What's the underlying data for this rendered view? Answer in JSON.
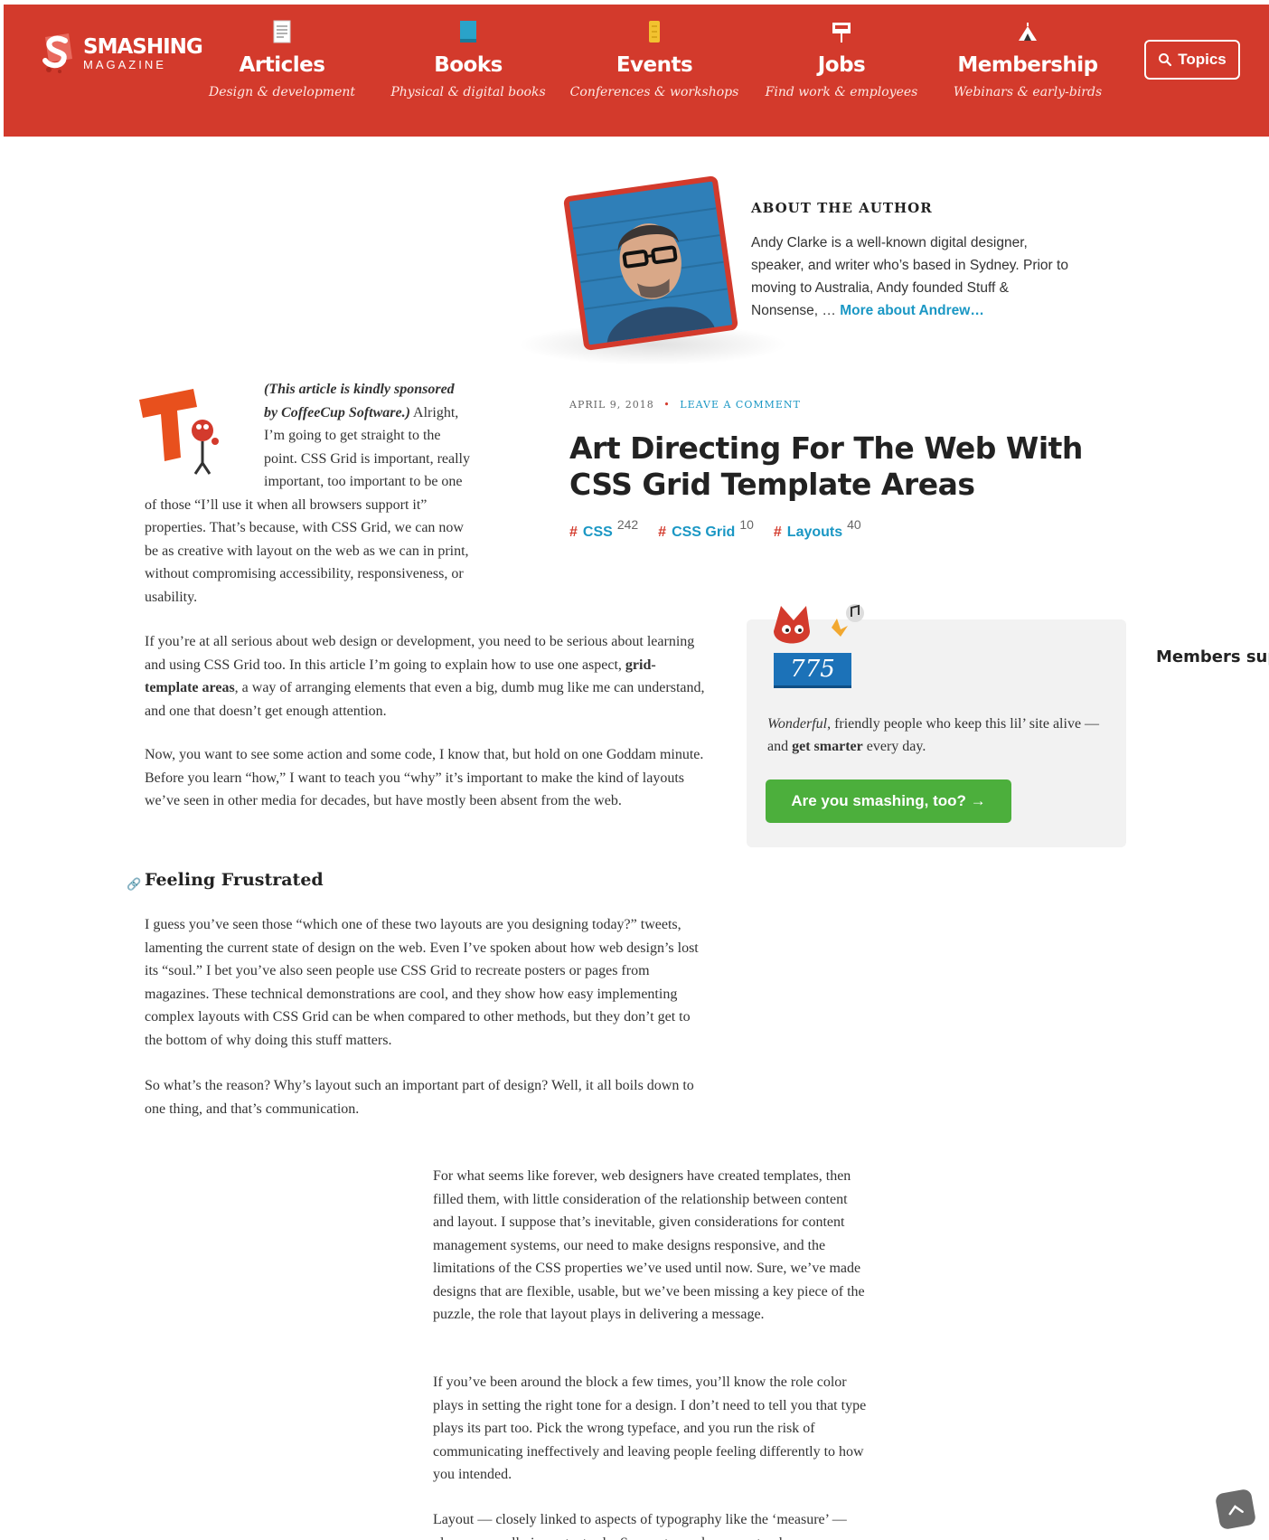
{
  "brand": {
    "name": "SMASHING",
    "sub": "MAGAZINE",
    "accent": "#d33a2c",
    "link": "#1a97c4",
    "success": "#4caf3c"
  },
  "nav": [
    {
      "label": "Articles",
      "sub": "Design & development",
      "icon": "document-icon"
    },
    {
      "label": "Books",
      "sub": "Physical & digital books",
      "icon": "book-icon"
    },
    {
      "label": "Events",
      "sub": "Conferences & workshops",
      "icon": "ticket-icon"
    },
    {
      "label": "Jobs",
      "sub": "Find work & employees",
      "icon": "jobs-sign-icon"
    },
    {
      "label": "Membership",
      "sub": "Webinars & early-birds",
      "icon": "tent-icon"
    }
  ],
  "search": {
    "label": "Topics"
  },
  "author": {
    "heading": "ABOUT THE AUTHOR",
    "bio": "Andy Clarke is a well-known digital designer, speaker, and writer who’s based in Sydney. Prior to moving to Australia, Andy founded Stuff & Nonsense, …",
    "more": "More about Andrew…"
  },
  "article": {
    "date": "APRIL 9, 2018",
    "comment": "LEAVE A COMMENT",
    "title": "Art Directing For The Web With CSS Grid Template Areas",
    "tags": [
      {
        "name": "CSS",
        "count": "242"
      },
      {
        "name": "CSS Grid",
        "count": "10"
      },
      {
        "name": "Layouts",
        "count": "40"
      }
    ],
    "intro_em": "(This article is kindly sponsored by CoffeeCup Software.)",
    "intro_rest": " Alright, I’m going to get straight to the point. CSS Grid is important, really important, too important to be one of those “I’ll use it when all browsers support it” properties. That’s because, with CSS Grid, we can now be as creative with layout on the web as we can in print, without compromising accessibility, responsiveness, or usability.",
    "p1_a": "If you’re at all serious about web design or development, you need to be serious about learning and using CSS Grid too. In this article I’m going to explain how to use one aspect, ",
    "p1_bold": "grid-template areas",
    "p1_b": ", a way of arranging elements that even a big, dumb mug like me can understand, and one that doesn’t get enough attention.",
    "p2": "Now, you want to see some action and some code, I know that, but hold on one Goddam minute. Before you learn “how,” I want to teach you “why” it’s important to make the kind of layouts we’ve seen in other media for decades, but have mostly been absent from the web.",
    "heading": "Feeling Frustrated",
    "p3": "I guess you’ve seen those “which one of these two layouts are you designing today?” tweets, lamenting the current state of design on the web. Even I’ve spoken about how web design’s lost its “soul.” I bet you’ve also seen people use CSS Grid to recreate posters or pages from magazines. These technical demonstrations are cool, and they show how easy implementing complex layouts with CSS Grid can be when compared to other methods, but they don’t get to the bottom of why doing this stuff matters.",
    "p4": "So what’s the reason? Why’s layout such an important part of design? Well, it all boils down to one thing, and that’s communication.",
    "p5": "For what seems like forever, web designers have created templates, then filled them, with little consideration of the relationship between content and layout. I suppose that’s inevitable, given considerations for content management systems, our need to make designs responsive, and the limitations of the CSS properties we’ve used until now. Sure, we’ve made designs that are flexible, usable, but we’ve been missing a key piece of the puzzle, the role that layout plays in delivering a message.",
    "p6": "If you’ve been around the block a few times, you’ll know the role color plays in setting the right tone for a design. I don’t need to tell you that type plays its part too. Pick the wrong typeface, and you run the risk of communicating ineffectively and leaving people feeling differently to how you intended.",
    "p7": "Layout — closely linked to aspects of typography like the ‘measure’ — plays an equally important role. Symmetry and asymmetry, harmony"
  },
  "members": {
    "count": "775",
    "text_em": "Wonderful",
    "text_a": ", friendly people who keep this lil’ site alive — and ",
    "text_bold": "get smarter",
    "text_b": " every day.",
    "button": "Are you smashing, too? →",
    "side_label": "Members sup"
  }
}
